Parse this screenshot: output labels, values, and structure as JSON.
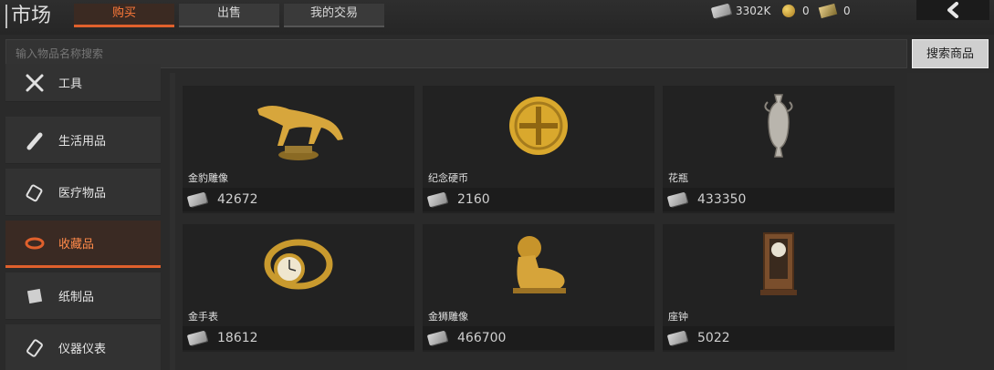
{
  "header": {
    "title": "市场",
    "tabs": [
      {
        "label": "购买",
        "active": true
      },
      {
        "label": "出售",
        "active": false
      },
      {
        "label": "我的交易",
        "active": false
      }
    ],
    "currencies": [
      {
        "icon": "cash-icon",
        "value": "3302K"
      },
      {
        "icon": "gold-coin-icon",
        "value": "0"
      },
      {
        "icon": "gold-bill-icon",
        "value": "0"
      }
    ],
    "back_icon": "chevron-left-icon"
  },
  "search": {
    "placeholder": "输入物品名称搜索",
    "value": "",
    "button_label": "搜索商品"
  },
  "sidebar": {
    "items": [
      {
        "label": "工具",
        "icon": "tools-icon",
        "active": false
      },
      {
        "label": "生活用品",
        "icon": "daily-goods-icon",
        "active": false
      },
      {
        "label": "医疗物品",
        "icon": "medical-icon",
        "active": false
      },
      {
        "label": "收藏品",
        "icon": "collectible-icon",
        "active": true
      },
      {
        "label": "纸制品",
        "icon": "paper-icon",
        "active": false
      },
      {
        "label": "仪器仪表",
        "icon": "instrument-icon",
        "active": false
      }
    ]
  },
  "items": [
    {
      "name": "金豹雕像",
      "price": "42672",
      "icon": "gold-leopard-statue-icon"
    },
    {
      "name": "纪念硬币",
      "price": "2160",
      "icon": "gold-coin-icon"
    },
    {
      "name": "花瓶",
      "price": "433350",
      "icon": "vase-icon"
    },
    {
      "name": "金手表",
      "price": "18612",
      "icon": "gold-watch-icon"
    },
    {
      "name": "金狮雕像",
      "price": "466700",
      "icon": "gold-lion-statue-icon"
    },
    {
      "name": "座钟",
      "price": "5022",
      "icon": "mantel-clock-icon"
    }
  ],
  "colors": {
    "accent": "#e0602c",
    "background": "#2a2a2a",
    "card": "#222222"
  }
}
